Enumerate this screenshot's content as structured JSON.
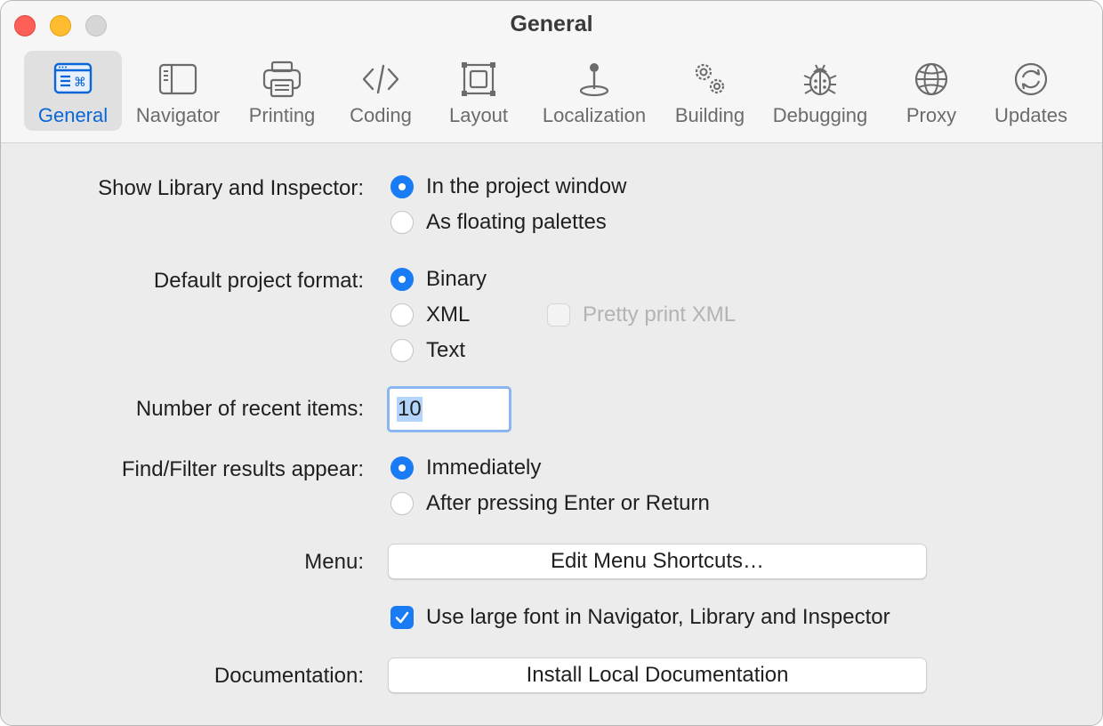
{
  "window": {
    "title": "General"
  },
  "tabs": [
    {
      "id": "general",
      "label": "General",
      "icon": "general-icon",
      "selected": true
    },
    {
      "id": "navigator",
      "label": "Navigator",
      "icon": "navigator-icon"
    },
    {
      "id": "printing",
      "label": "Printing",
      "icon": "printer-icon"
    },
    {
      "id": "coding",
      "label": "Coding",
      "icon": "code-icon"
    },
    {
      "id": "layout",
      "label": "Layout",
      "icon": "layout-icon"
    },
    {
      "id": "localization",
      "label": "Localization",
      "icon": "location-pin-icon"
    },
    {
      "id": "building",
      "label": "Building",
      "icon": "gears-icon"
    },
    {
      "id": "debugging",
      "label": "Debugging",
      "icon": "bug-icon"
    },
    {
      "id": "proxy",
      "label": "Proxy",
      "icon": "globe-icon"
    },
    {
      "id": "updates",
      "label": "Updates",
      "icon": "refresh-icon"
    }
  ],
  "settings": {
    "library_inspector": {
      "label": "Show Library and Inspector:",
      "options": [
        "In the project window",
        "As floating palettes"
      ],
      "selected": "In the project window"
    },
    "project_format": {
      "label": "Default project format:",
      "options": [
        "Binary",
        "XML",
        "Text"
      ],
      "selected": "Binary",
      "pretty_print_label": "Pretty print XML",
      "pretty_print_checked": false,
      "pretty_print_enabled": false
    },
    "recent_items": {
      "label": "Number of recent items:",
      "value": "10"
    },
    "find_filter": {
      "label": "Find/Filter results appear:",
      "options": [
        "Immediately",
        "After pressing Enter or Return"
      ],
      "selected": "Immediately"
    },
    "menu": {
      "label": "Menu:",
      "button_label": "Edit Menu Shortcuts…"
    },
    "large_font": {
      "label": "Use large font in Navigator, Library and Inspector",
      "checked": true
    },
    "documentation": {
      "label": "Documentation:",
      "button_label": "Install Local Documentation"
    }
  },
  "colors": {
    "accent": "#1a7cf5",
    "selected_tab_label": "#0a66d8"
  }
}
